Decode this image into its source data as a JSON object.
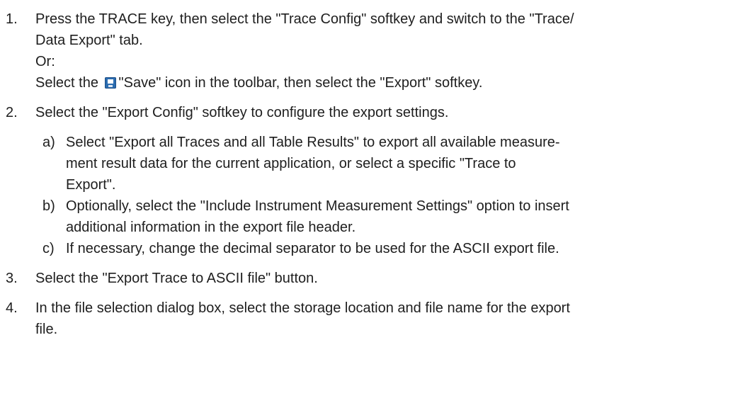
{
  "steps": [
    {
      "num": "1.",
      "line1": "Press the TRACE key, then select the \"Trace Config\" softkey and switch to the \"Trace/",
      "line2": "Data Export\" tab.",
      "or": "Or:",
      "save_prefix": "Select the",
      "save_icon": "save-icon",
      "save_suffix": "\"Save\" icon in the toolbar, then select the \"Export\" softkey."
    },
    {
      "num": "2.",
      "text": "Select the \"Export Config\" softkey to configure the export settings.",
      "substeps": [
        {
          "label": "a)",
          "lines": [
            "Select \"Export all Traces and all Table Results\" to export all available measure-",
            "ment result data for the current application, or select a specific \"Trace to",
            "Export\"."
          ]
        },
        {
          "label": "b)",
          "lines": [
            "Optionally, select the \"Include Instrument Measurement Settings\" option to insert",
            "additional information in the export file header."
          ]
        },
        {
          "label": "c)",
          "lines": [
            "If necessary, change the decimal separator to be used for the ASCII export file."
          ]
        }
      ]
    },
    {
      "num": "3.",
      "text": "Select the \"Export Trace to ASCII file\" button."
    },
    {
      "num": "4.",
      "line1": "In the file selection dialog box, select the storage location and file name for the export",
      "line2": "file."
    }
  ]
}
